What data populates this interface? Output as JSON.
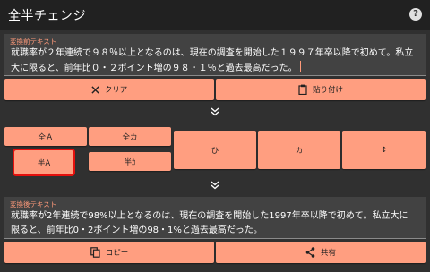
{
  "app": {
    "title": "全半チェンジ"
  },
  "input": {
    "caption": "変換前テキスト",
    "text": "就職率が２年連続で９８％以上となるのは、現在の調査を開始した１９９７年卒以降で初めて。私立大に限ると、前年比０・２ポイント増の９８・１％と過去最高だった。"
  },
  "actions_top": {
    "clear_label": "クリア",
    "paste_label": "貼り付け"
  },
  "convert": {
    "full_alpha": "全Ａ",
    "full_kana": "全カ",
    "half_alpha": "半A",
    "half_kana": "半ｶ",
    "hiragana": "ひ",
    "katakana": "カ",
    "swap": "↕"
  },
  "output": {
    "caption": "変換後テキスト",
    "text": "就職率が2年連続で98%以上となるのは、現在の調査を開始した1997年卒以降で初めて。私立大に限ると、前年比0・2ポイント増の98・1%と過去最高だった。"
  },
  "actions_bottom": {
    "copy_label": "コピー",
    "share_label": "共有"
  },
  "colors": {
    "accent": "#ff9e80",
    "highlight": "#e5100d",
    "background": "#303030"
  }
}
